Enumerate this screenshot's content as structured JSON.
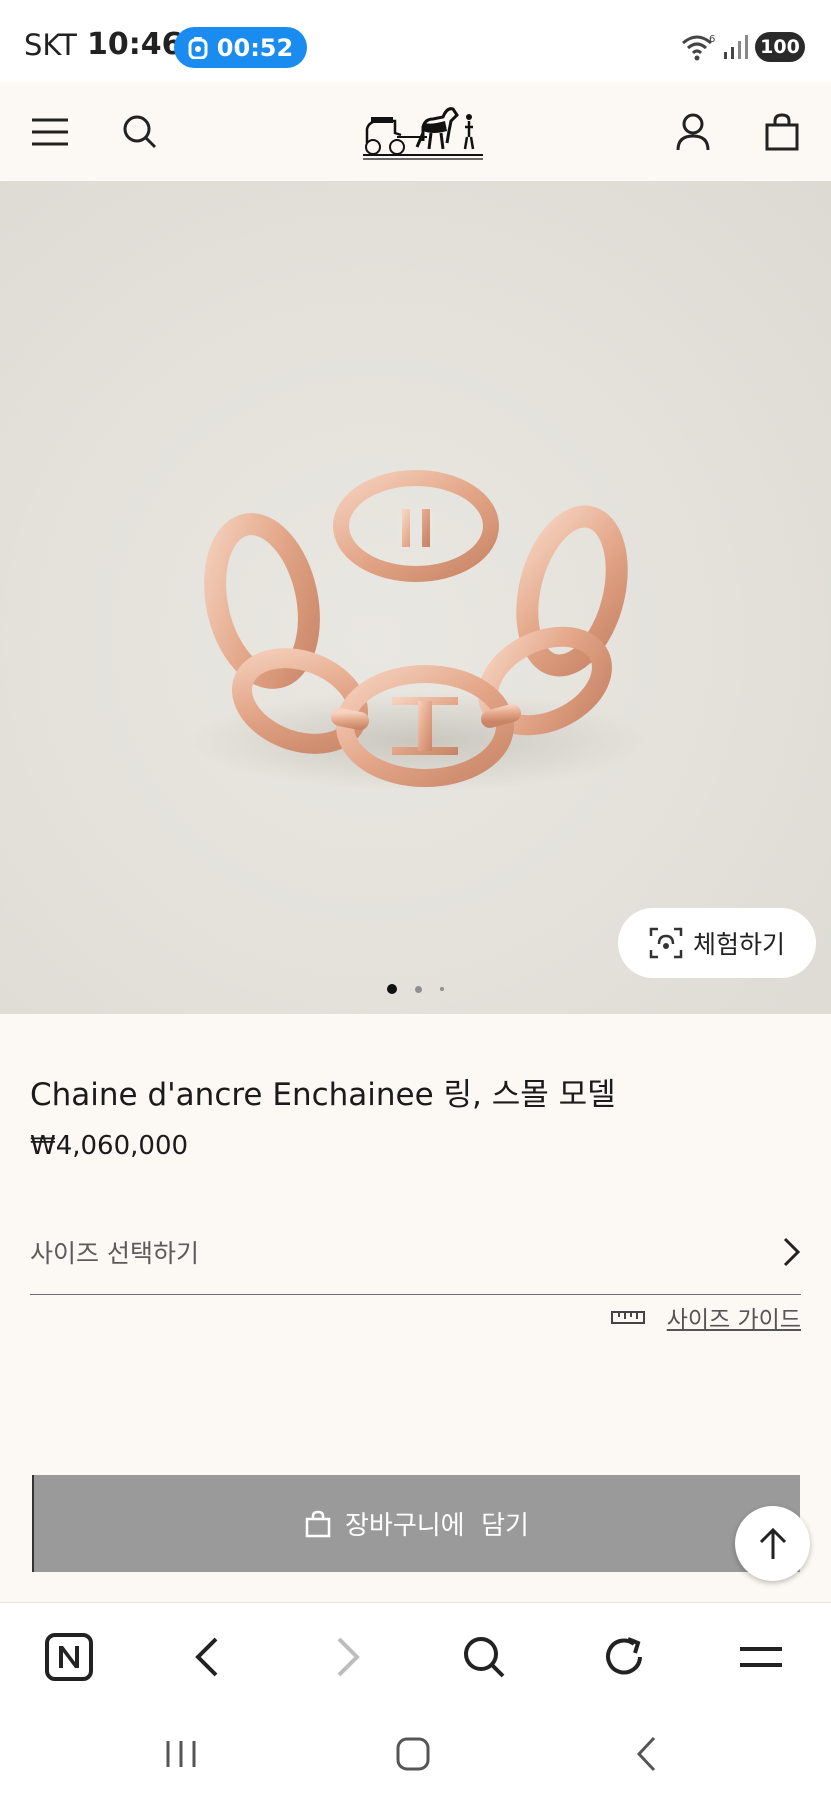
{
  "status_bar": {
    "carrier": "SKT",
    "time": "10:46",
    "timer": "00:52",
    "wifi_badge": "6",
    "battery": "100"
  },
  "header": {
    "icons": [
      "menu-icon",
      "search-icon",
      "hermes-logo",
      "account-icon",
      "shopping-bag-icon"
    ]
  },
  "hero": {
    "try_on_label": "체험하기",
    "carousel": {
      "count": 3,
      "active": 0
    }
  },
  "product": {
    "name": "Chaine d'ancre Enchainee 링, 스몰 모델",
    "price": "₩4,060,000",
    "size_select_label": "사이즈 선택하기",
    "size_guide_label": "사이즈 가이드",
    "add_to_cart_label": "장바구니에  담기"
  },
  "browser_bar": {
    "icons": [
      "naver-home-icon",
      "back-icon",
      "forward-icon",
      "search-icon",
      "reload-icon",
      "menu-icon"
    ]
  },
  "colors": {
    "header_bg": "#fcf8f3",
    "timer_pill": "#1a8cf0",
    "cart_button": "#9a9a9a",
    "ring_gold": "#e0a68b"
  }
}
